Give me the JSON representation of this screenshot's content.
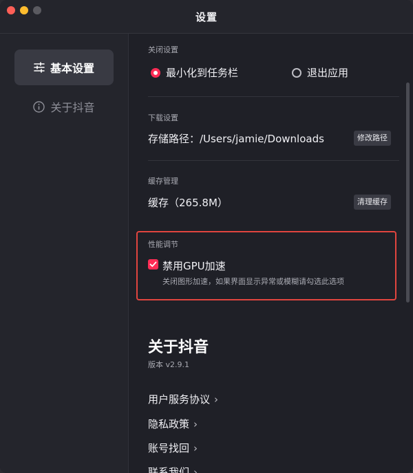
{
  "window": {
    "title": "设置"
  },
  "sidebar": {
    "items": [
      {
        "label": "基本设置",
        "icon": "sliders-icon",
        "active": true
      },
      {
        "label": "关于抖音",
        "icon": "info-icon",
        "active": false
      }
    ]
  },
  "close_settings": {
    "section_title": "关闭设置",
    "options": [
      {
        "label": "最小化到任务栏",
        "selected": true
      },
      {
        "label": "退出应用",
        "selected": false
      }
    ]
  },
  "download_settings": {
    "section_title": "下载设置",
    "path_label": "存储路径：/Users/jamie/Downloads",
    "button": "修改路径"
  },
  "cache": {
    "section_title": "缓存管理",
    "label": "缓存（265.8M）",
    "button": "清理缓存"
  },
  "performance": {
    "section_title": "性能调节",
    "checkbox_label": "禁用GPU加速",
    "checked": true,
    "description": "关闭图形加速，如果界面显示异常或模糊请勾选此选项"
  },
  "about": {
    "title": "关于抖音",
    "version": "版本 v2.9.1",
    "links": [
      "用户服务协议",
      "隐私政策",
      "账号找回",
      "联系我们"
    ]
  },
  "colors": {
    "accent": "#fe2c55",
    "highlight": "#e2453f",
    "background": "#1f2027",
    "sidebar": "#24252c"
  }
}
